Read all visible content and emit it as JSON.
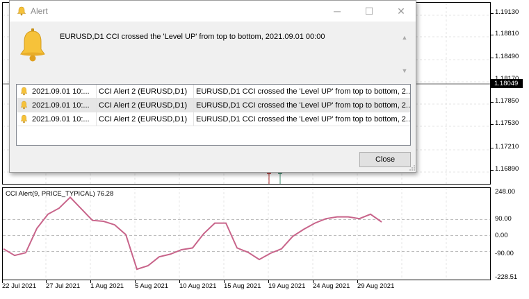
{
  "dialog": {
    "title": "Alert",
    "message": "EURUSD,D1 CCI crossed the 'Level UP' from top to bottom, 2021.09.01 00:00",
    "rows": [
      {
        "time": "2021.09.01 10:...",
        "name": "CCI Alert 2 (EURUSD,D1)",
        "message": "EURUSD,D1 CCI crossed the 'Level UP' from top to bottom, 2..."
      },
      {
        "time": "2021.09.01 10:...",
        "name": "CCI Alert 2 (EURUSD,D1)",
        "message": "EURUSD,D1 CCI crossed the 'Level UP' from top to bottom, 2..."
      },
      {
        "time": "2021.09.01 10:...",
        "name": "CCI Alert 2 (EURUSD,D1)",
        "message": "EURUSD,D1 CCI crossed the 'Level UP' from top to bottom, 2..."
      }
    ],
    "close_label": "Close",
    "minimize_glyph": "─",
    "maximize_glyph": "☐",
    "close_glyph": "✕",
    "scroll_up_glyph": "▲",
    "scroll_down_glyph": "▼",
    "selected_row": 1,
    "bell_color": "#f6c23a"
  },
  "chart": {
    "price_labels": [
      "1.19130",
      "1.18810",
      "1.18490",
      "1.18170",
      "1.17850",
      "1.17530",
      "1.17210",
      "1.16890"
    ],
    "current_price": "1.18049",
    "cci_title": "CCI Alert(9, PRICE_TYPICAL) 76.28",
    "cci_labels": [
      "248.00",
      "90.00",
      "0.00",
      "-90.00",
      "-228.51"
    ],
    "date_labels": [
      "22 Jul 2021",
      "27 Jul 2021",
      "1 Aug 2021",
      "5 Aug 2021",
      "10 Aug 2021",
      "15 Aug 2021",
      "19 Aug 2021",
      "24 Aug 2021",
      "29 Aug 2021"
    ]
  },
  "chart_data": {
    "type": "line",
    "title": "CCI Alert(9, PRICE_TYPICAL) 76.28",
    "ylim": [
      -228.51,
      248.0
    ],
    "levels": [
      90,
      0,
      -90
    ],
    "series": [
      {
        "name": "CCI Alert(9, PRICE_TYPICAL)",
        "color": "#c8648a",
        "values": [
          -75,
          -112,
          -97,
          40,
          120,
          154,
          215,
          150,
          85,
          80,
          60,
          5,
          -190,
          -170,
          -120,
          -105,
          -80,
          -70,
          10,
          70,
          70,
          -70,
          -95,
          -135,
          -100,
          -75,
          -5,
          35,
          70,
          95,
          105,
          105,
          95,
          120,
          76
        ]
      }
    ]
  }
}
